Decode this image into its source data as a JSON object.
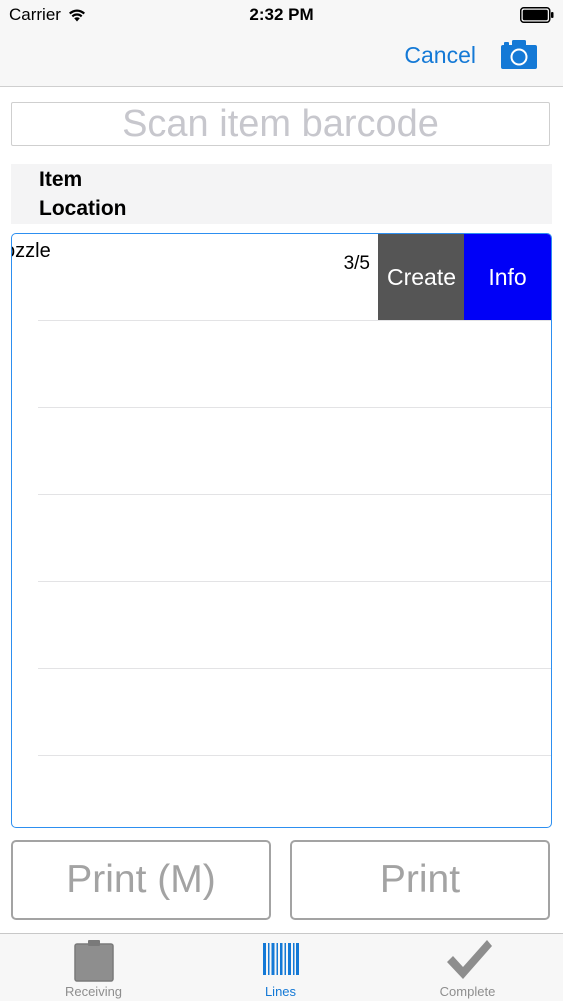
{
  "status_bar": {
    "carrier": "Carrier",
    "time": "2:32 PM"
  },
  "nav": {
    "cancel_label": "Cancel",
    "camera_icon": "camera-icon"
  },
  "scan": {
    "placeholder": "Scan item barcode"
  },
  "header": {
    "item_label": "Item",
    "location_label": "Location"
  },
  "rows": [
    {
      "text": "ozzle",
      "qty": "3/5",
      "actions": {
        "create": "Create",
        "info": "Info"
      }
    }
  ],
  "buttons": {
    "print_m": "Print (M)",
    "print": "Print"
  },
  "tabs": [
    {
      "label": "Receiving",
      "icon": "clipboard-icon"
    },
    {
      "label": "Lines",
      "icon": "barcode-icon",
      "selected": true
    },
    {
      "label": "Complete",
      "icon": "checkmark-icon"
    }
  ],
  "colors": {
    "accent": "#1479d6",
    "create_action": "#555555",
    "info_action": "#0000f7",
    "disabled_button": "#a3a3a3",
    "tab_inactive": "#8e8e8e"
  }
}
